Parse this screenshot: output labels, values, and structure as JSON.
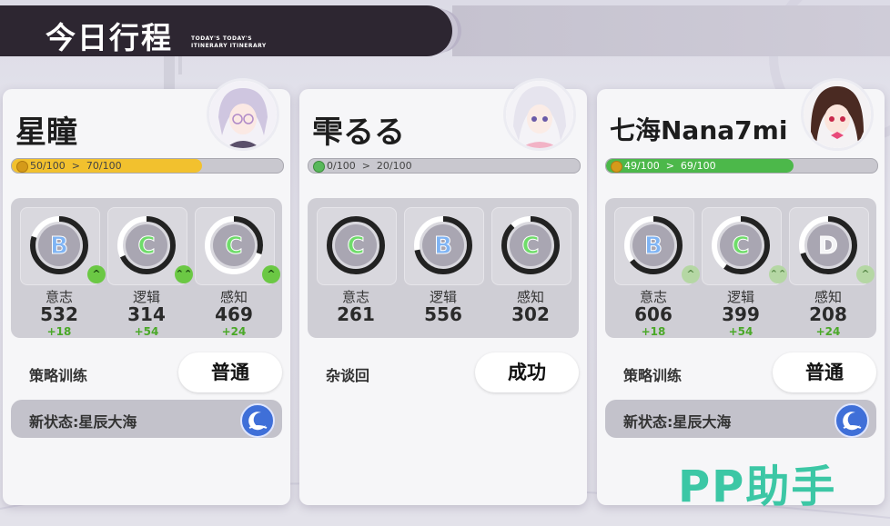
{
  "header": {
    "title": "今日行程",
    "subtitle_line1": "TODAY'S TODAY'S",
    "subtitle_line2": "ITINERARY ITINERARY"
  },
  "colors": {
    "ring_track": "#ffffff",
    "ring_fill": "#222222",
    "grade_B": "#7fb4f4",
    "grade_C": "#6fdc6a",
    "grade_D": "#f4f4f6",
    "bar_gold": "#f2c12e",
    "bar_green": "#4cb84a",
    "bar_gray": "#c9c8cf"
  },
  "cards": [
    {
      "name": "星瞳",
      "avatar": "character-avatar-xingtong",
      "bar": {
        "text": "50/100  >  70/100",
        "from": 50,
        "to": 70,
        "color": "#f2c12e"
      },
      "stats": [
        {
          "grade": "B",
          "label": "意志",
          "value": "532",
          "delta": "+18",
          "level": 0.8,
          "arrow": "up-single",
          "arrow_glyph": "^",
          "faint": false
        },
        {
          "grade": "C",
          "label": "逻辑",
          "value": "314",
          "delta": "+54",
          "level": 0.68,
          "arrow": "up-double",
          "arrow_glyph": "⌃⌃",
          "faint": false
        },
        {
          "grade": "C",
          "label": "感知",
          "value": "469",
          "delta": "+24",
          "level": 0.3,
          "arrow": "up-single",
          "arrow_glyph": "^",
          "faint": false
        }
      ],
      "action": {
        "label": "策略训练",
        "result": "普通"
      },
      "state": {
        "label": "新状态:星辰大海",
        "icon": "moon-star-icon"
      }
    },
    {
      "name": "雫るる",
      "avatar": "character-avatar-shizuku-lulu",
      "bar": {
        "text": "0/100  >  20/100",
        "from": 0,
        "to": 20,
        "color": "#c9c8cf"
      },
      "stats": [
        {
          "grade": "C",
          "label": "意志",
          "value": "261",
          "delta": "",
          "level": 1.0,
          "arrow": "",
          "arrow_glyph": "",
          "faint": false
        },
        {
          "grade": "B",
          "label": "逻辑",
          "value": "556",
          "delta": "",
          "level": 0.72,
          "arrow": "",
          "arrow_glyph": "",
          "faint": false
        },
        {
          "grade": "C",
          "label": "感知",
          "value": "302",
          "delta": "",
          "level": 0.88,
          "arrow": "",
          "arrow_glyph": "",
          "faint": false
        }
      ],
      "action": {
        "label": "杂谈回",
        "result": "成功"
      },
      "state": null
    },
    {
      "name": "七海Nana7mi",
      "avatar": "character-avatar-nana7mi",
      "bar": {
        "text": "49/100  >  69/100",
        "from": 49,
        "to": 69,
        "color": "#4cb84a"
      },
      "stats": [
        {
          "grade": "B",
          "label": "意志",
          "value": "606",
          "delta": "+18",
          "level": 0.65,
          "arrow": "up-single",
          "arrow_glyph": "^",
          "faint": true
        },
        {
          "grade": "C",
          "label": "逻辑",
          "value": "399",
          "delta": "+54",
          "level": 0.6,
          "arrow": "up-double",
          "arrow_glyph": "⌃⌃",
          "faint": true
        },
        {
          "grade": "D",
          "label": "感知",
          "value": "208",
          "delta": "+24",
          "level": 0.7,
          "arrow": "up-single",
          "arrow_glyph": "^",
          "faint": true
        }
      ],
      "action": {
        "label": "策略训练",
        "result": "普通"
      },
      "state": {
        "label": "新状态:星辰大海",
        "icon": "moon-star-icon"
      }
    }
  ],
  "watermark": "PP助手"
}
